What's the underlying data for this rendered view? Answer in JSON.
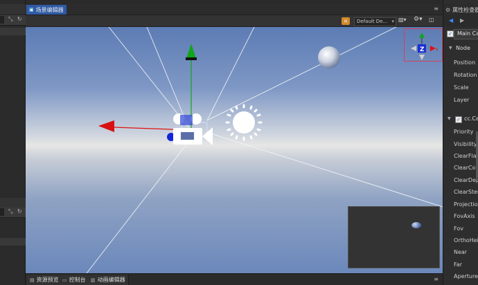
{
  "scene": {
    "tab_label": "场景编辑器",
    "camera_select": "Default De...",
    "bottom_tabs": [
      "资源预览",
      "控制台",
      "动画编辑器"
    ]
  },
  "gizmo": {
    "z_label": "Z",
    "x_label": "x"
  },
  "inspector": {
    "title": "属性检查器",
    "node_name": "Main Ca",
    "node_section": "Node",
    "node_props": [
      "Position",
      "Rotation",
      "Scale",
      "Layer"
    ],
    "camera_section": "cc.Ca",
    "camera_props": [
      "Priority",
      "Visibility",
      "ClearFlags",
      "ClearColor",
      "ClearDepth",
      "ClearStenc",
      "Projection",
      "FovAxis",
      "Fov",
      "OrthoHeigh",
      "Near",
      "Far",
      "Aperture"
    ]
  },
  "colors": {
    "accent": "#2f5aa6",
    "axis_x": "#e01010",
    "axis_y": "#12a51b",
    "axis_z": "#1020d0"
  }
}
